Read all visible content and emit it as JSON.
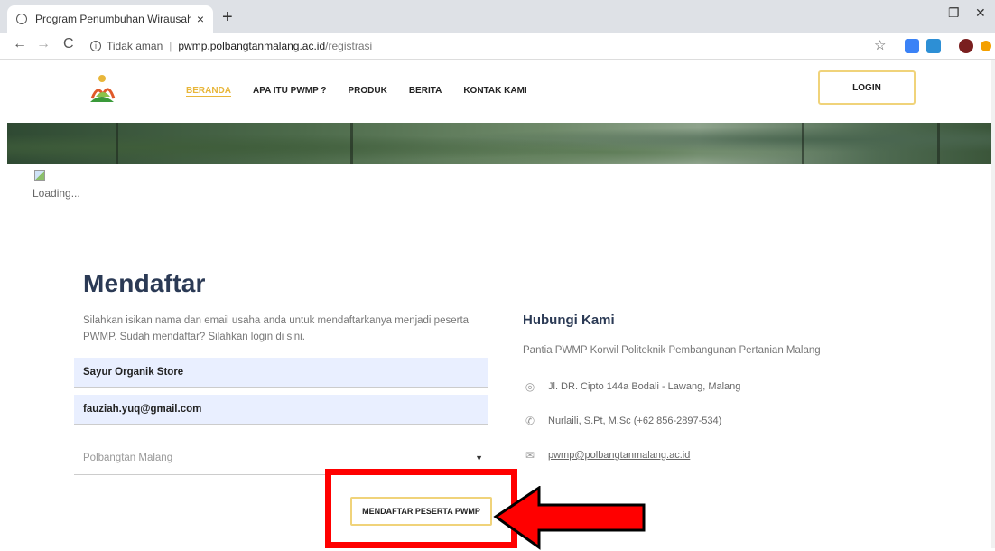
{
  "browser": {
    "tab_title": "Program Penumbuhan Wirausaha",
    "close_tab": "×",
    "new_tab": "+",
    "window_min": "–",
    "window_max": "❐",
    "window_close": "✕",
    "security_label": "Tidak aman",
    "url_host": "pwmp.polbangtanmalang.ac.id",
    "url_path": "/registrasi"
  },
  "nav": {
    "items": [
      "BERANDA",
      "APA ITU PWMP ?",
      "PRODUK",
      "BERITA",
      "KONTAK KAMI"
    ],
    "login": "LOGIN"
  },
  "page": {
    "loading": "Loading...",
    "heading": "Mendaftar",
    "intro": "Silahkan isikan nama dan email usaha anda untuk mendaftarkanya menjadi peserta PWMP. Sudah mendaftar? Silahkan login ",
    "intro_link": "di sini",
    "intro_end": ".",
    "business_name": "Sayur Organik Store",
    "email": "fauziah.yuq@gmail.com",
    "institution": "Polbangtan Malang",
    "submit": "MENDAFTAR PESERTA PWMP"
  },
  "contact": {
    "title": "Hubungi Kami",
    "subtitle": "Pantia PWMP Korwil Politeknik Pembangunan Pertanian Malang",
    "address": "Jl. DR. Cipto 144a Bodali - Lawang, Malang",
    "phone": "Nurlaili, S.Pt, M.Sc (+62 856-2897-534)",
    "email": "pwmp@polbangtanmalang.ac.id"
  },
  "colors": {
    "accent": "#e8b63a",
    "heading": "#2b3a55",
    "annotation": "#ff0000"
  }
}
